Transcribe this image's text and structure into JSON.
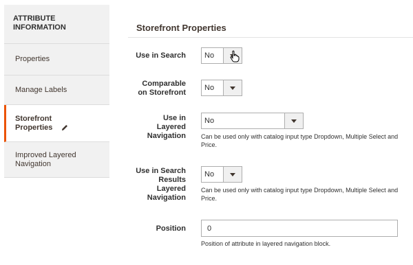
{
  "sidebar": {
    "heading": "ATTRIBUTE INFORMATION",
    "items": [
      {
        "label": "Properties"
      },
      {
        "label": "Manage Labels"
      },
      {
        "label": "Storefront Properties"
      },
      {
        "label": "Improved Layered Navigation"
      }
    ],
    "accent_color": "#eb5202"
  },
  "main": {
    "section_title": "Storefront Properties",
    "fields": {
      "use_in_search": {
        "label": "Use in Search",
        "value": "No"
      },
      "comparable": {
        "label": "Comparable on Storefront",
        "value": "No"
      },
      "layered_nav": {
        "label": "Use in Layered Navigation",
        "value": "No",
        "note": "Can be used only with catalog input type Dropdown, Multiple Select and Price."
      },
      "search_results_nav": {
        "label": "Use in Search Results Layered Navigation",
        "value": "No",
        "note": "Can be used only with catalog input type Dropdown, Multiple Select and Price."
      },
      "position": {
        "label": "Position",
        "value": "0",
        "note": "Position of attribute in layered navigation block."
      }
    }
  }
}
